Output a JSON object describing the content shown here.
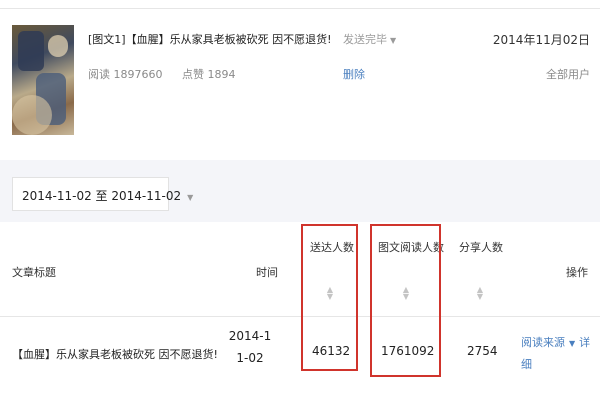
{
  "article": {
    "title": "[图文1]【血腥】乐从家具老板被砍死 因不愿退货!",
    "read_label": "阅读 1897660",
    "like_label": "点赞 1894",
    "send_status": "发送完毕",
    "delete_label": "删除",
    "date": "2014年11月02日",
    "audience": "全部用户"
  },
  "filter": {
    "date_range": "2014-11-02 至 2014-11-02"
  },
  "table": {
    "headers": {
      "title": "文章标题",
      "time": "时间",
      "delivered": "送达人数",
      "read": "图文阅读人数",
      "share": "分享人数",
      "actions": "操作"
    },
    "rows": [
      {
        "title": "【血腥】乐从家具老板被砍死 因不愿退货!",
        "time": "2014-11-02",
        "delivered": "46132",
        "read": "1761092",
        "share": "2754",
        "source_link": "阅读来源",
        "detail_link": "详细"
      }
    ]
  },
  "colors": {
    "link": "#4a7fbf",
    "highlight_box": "#d0342c",
    "band_bg": "#f4f5f9"
  },
  "icons": [
    "caret-down-icon",
    "sort-icon"
  ]
}
